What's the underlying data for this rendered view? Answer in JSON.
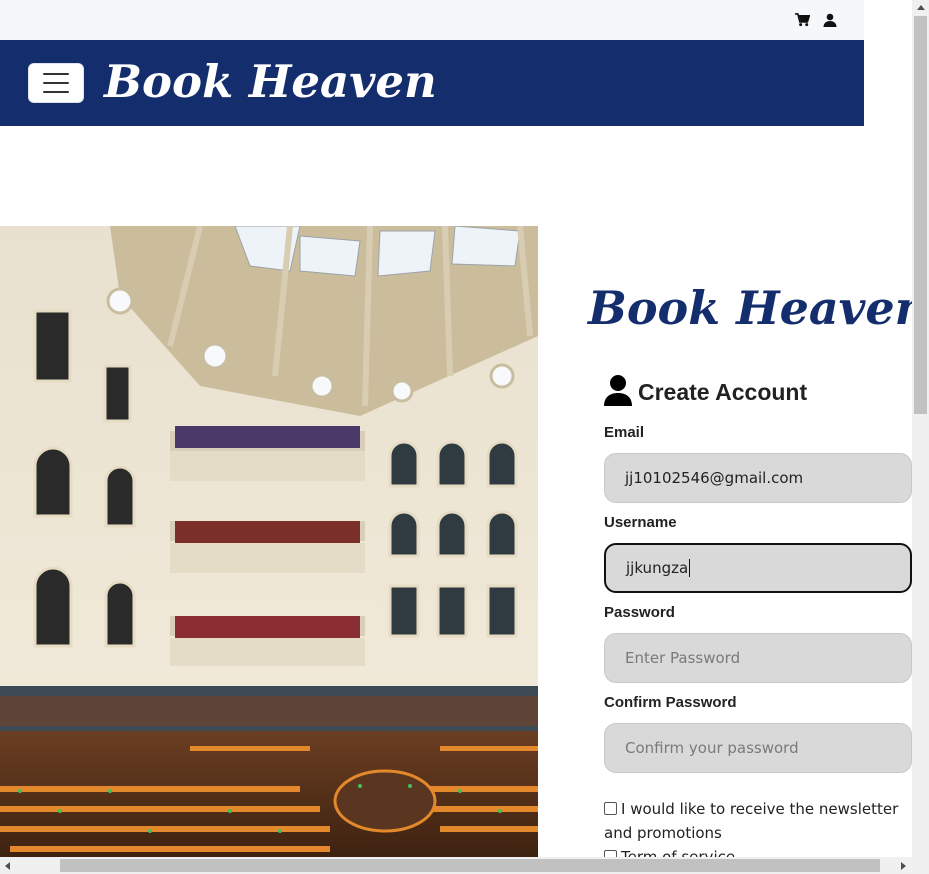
{
  "topbar": {
    "cart_icon": "cart-icon",
    "user_icon": "user-icon"
  },
  "navbar": {
    "menu_icon": "hamburger-icon",
    "brand": "Book Heaven",
    "background": "#142d6d"
  },
  "hero": {
    "image": "library-reading-room-photo"
  },
  "form": {
    "logo": "Book Heaven",
    "title": "Create Account",
    "email_label": "Email",
    "email_value": "jj10102546@gmail.com",
    "username_label": "Username",
    "username_value": "jjkungza",
    "password_label": "Password",
    "password_placeholder": "Enter Password",
    "confirm_label": "Confirm Password",
    "confirm_placeholder": "Confirm your password",
    "newsletter_label": "I would like to receive the newsletter and promotions",
    "terms_label": "Term of service"
  }
}
